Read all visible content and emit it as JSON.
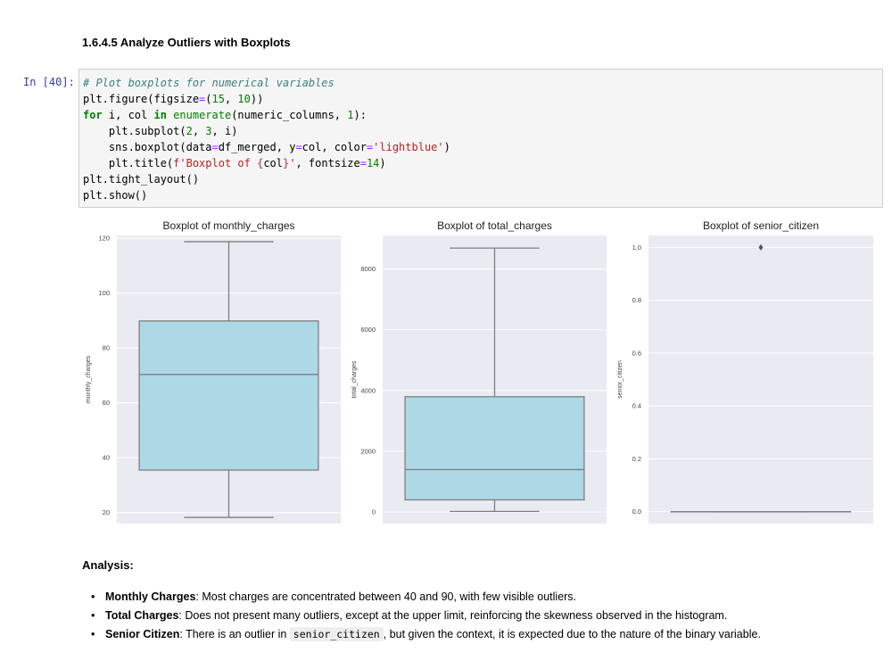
{
  "heading": "1.6.4.5 Analyze Outliers with Boxplots",
  "cell": {
    "prompt": "In [40]:",
    "lines": [
      "# Plot boxplots for numerical variables",
      "plt.figure(figsize=(15, 10))",
      "for i, col in enumerate(numeric_columns, 1):",
      "    plt.subplot(2, 3, i)",
      "    sns.boxplot(data=df_merged, y=col, color='lightblue')",
      "    plt.title(f'Boxplot of {col}', fontsize=14)",
      "plt.tight_layout()",
      "plt.show()"
    ]
  },
  "chart_data": [
    {
      "type": "boxplot",
      "title": "Boxplot of monthly_charges",
      "ylabel": "monthly_charges",
      "ylim": [
        16,
        121
      ],
      "yticks": [
        "20",
        "40",
        "60",
        "80",
        "100",
        "120"
      ],
      "box": {
        "whisker_low": 18.25,
        "q1": 35.5,
        "median": 70.35,
        "q3": 89.85,
        "whisker_high": 118.75
      },
      "fliers": [],
      "colors": {
        "box": "#add8e6",
        "background": "#eaeaf2",
        "lines": "#7f7f7f"
      }
    },
    {
      "type": "boxplot",
      "title": "Boxplot of total_charges",
      "ylabel": "total_charges",
      "ylim": [
        -380,
        9100
      ],
      "yticks": [
        "0",
        "2000",
        "4000",
        "6000",
        "8000"
      ],
      "box": {
        "whisker_low": 18.8,
        "q1": 401.4,
        "median": 1397.5,
        "q3": 3794.7,
        "whisker_high": 8684.8
      },
      "fliers": [],
      "colors": {
        "box": "#add8e6",
        "background": "#eaeaf2",
        "lines": "#7f7f7f"
      }
    },
    {
      "type": "boxplot",
      "title": "Boxplot of senior_citizen",
      "ylabel": "senior_citizen",
      "ylim": [
        -0.045,
        1.045
      ],
      "yticks": [
        "0.0",
        "0.2",
        "0.4",
        "0.6",
        "0.8",
        "1.0"
      ],
      "box": {
        "whisker_low": 0,
        "q1": 0,
        "median": 0,
        "q3": 0,
        "whisker_high": 0
      },
      "fliers": [
        1.0
      ],
      "colors": {
        "box": "#add8e6",
        "background": "#eaeaf2",
        "lines": "#7f7f7f"
      }
    }
  ],
  "analysis": {
    "title": "Analysis:",
    "items": [
      {
        "term": "Monthly Charges",
        "text": ": Most charges are concentrated between 40 and 90, with few visible outliers."
      },
      {
        "term": "Total Charges",
        "text": ": Does not present many outliers, except at the upper limit, reinforcing the skewness observed in the histogram."
      },
      {
        "term": "Senior Citizen",
        "text_before": ": There is an outlier in ",
        "code": "senior_citizen",
        "text_after": ", but given the context, it is expected due to the nature of the binary variable."
      }
    ]
  }
}
